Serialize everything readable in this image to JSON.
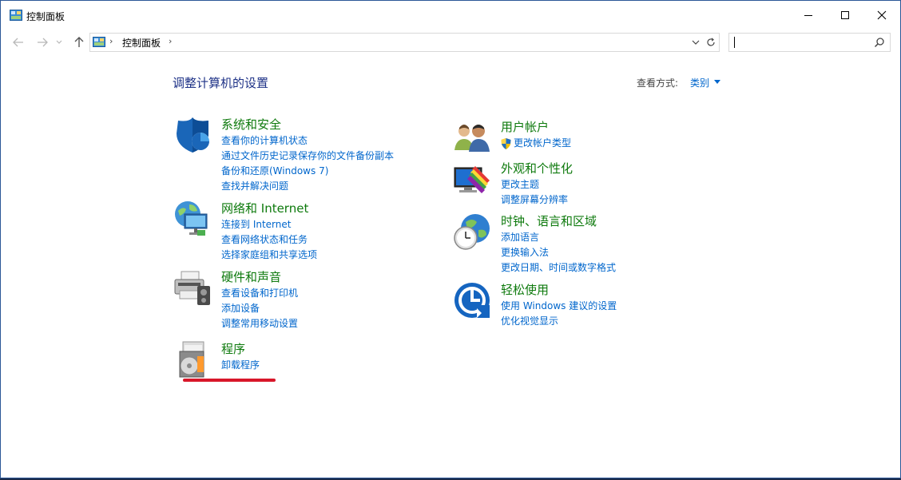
{
  "window": {
    "title": "控制面板",
    "min_label": "minimize",
    "max_label": "maximize",
    "close_label": "close"
  },
  "nav": {
    "breadcrumb": "控制面板",
    "search_value": ""
  },
  "content": {
    "page_title": "调整计算机的设置",
    "viewby_label": "查看方式:",
    "viewby_value": "类别"
  },
  "left_categories": [
    {
      "icon": "shield-icon",
      "title": "系统和安全",
      "links": [
        "查看你的计算机状态",
        "通过文件历史记录保存你的文件备份副本",
        "备份和还原(Windows 7)",
        "查找并解决问题"
      ]
    },
    {
      "icon": "network-globe-icon",
      "title": "网络和 Internet",
      "links": [
        "连接到 Internet",
        "查看网络状态和任务",
        "选择家庭组和共享选项"
      ]
    },
    {
      "icon": "printer-icon",
      "title": "硬件和声音",
      "links": [
        "查看设备和打印机",
        "添加设备",
        "调整常用移动设置"
      ]
    },
    {
      "icon": "programs-disc-icon",
      "title": "程序",
      "links": [
        "卸载程序"
      ]
    }
  ],
  "right_categories": [
    {
      "icon": "users-icon",
      "title": "用户帐户",
      "links": [
        "更改帐户类型"
      ]
    },
    {
      "icon": "appearance-icon",
      "title": "外观和个性化",
      "links": [
        "更改主题",
        "调整屏幕分辨率"
      ]
    },
    {
      "icon": "clock-globe-icon",
      "title": "时钟、语言和区域",
      "links": [
        "添加语言",
        "更换输入法",
        "更改日期、时间或数字格式"
      ]
    },
    {
      "icon": "ease-of-access-icon",
      "title": "轻松使用",
      "links": [
        "使用 Windows 建议的设置",
        "优化视觉显示"
      ]
    }
  ],
  "colors": {
    "category_title": "#0e7a0d",
    "link": "#0066cc",
    "page_title": "#1e3287",
    "annotation_underline": "#d8172a"
  }
}
